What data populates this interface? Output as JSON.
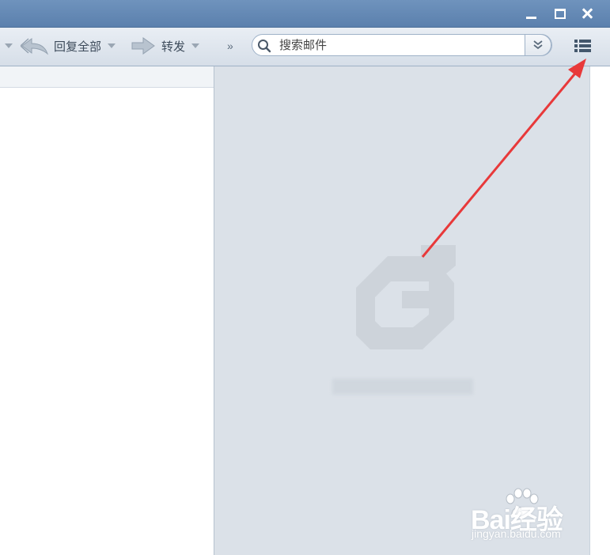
{
  "toolbar": {
    "reply_all_label": "回复全部",
    "forward_label": "转发",
    "more_label": "»",
    "search_placeholder": "搜索邮件"
  },
  "watermark": {
    "brand": "Bai经验",
    "url": "jingyan.baidu.com"
  },
  "colors": {
    "titlebar": "#5b80ad",
    "arrow": "#e8393a",
    "pane_bg": "#dbe1e8"
  },
  "icons": [
    "minimize-icon",
    "maximize-icon",
    "close-icon",
    "reply-all-icon",
    "forward-icon",
    "search-icon",
    "chevron-double-down-icon",
    "list-menu-icon",
    "app-logo-icon"
  ]
}
